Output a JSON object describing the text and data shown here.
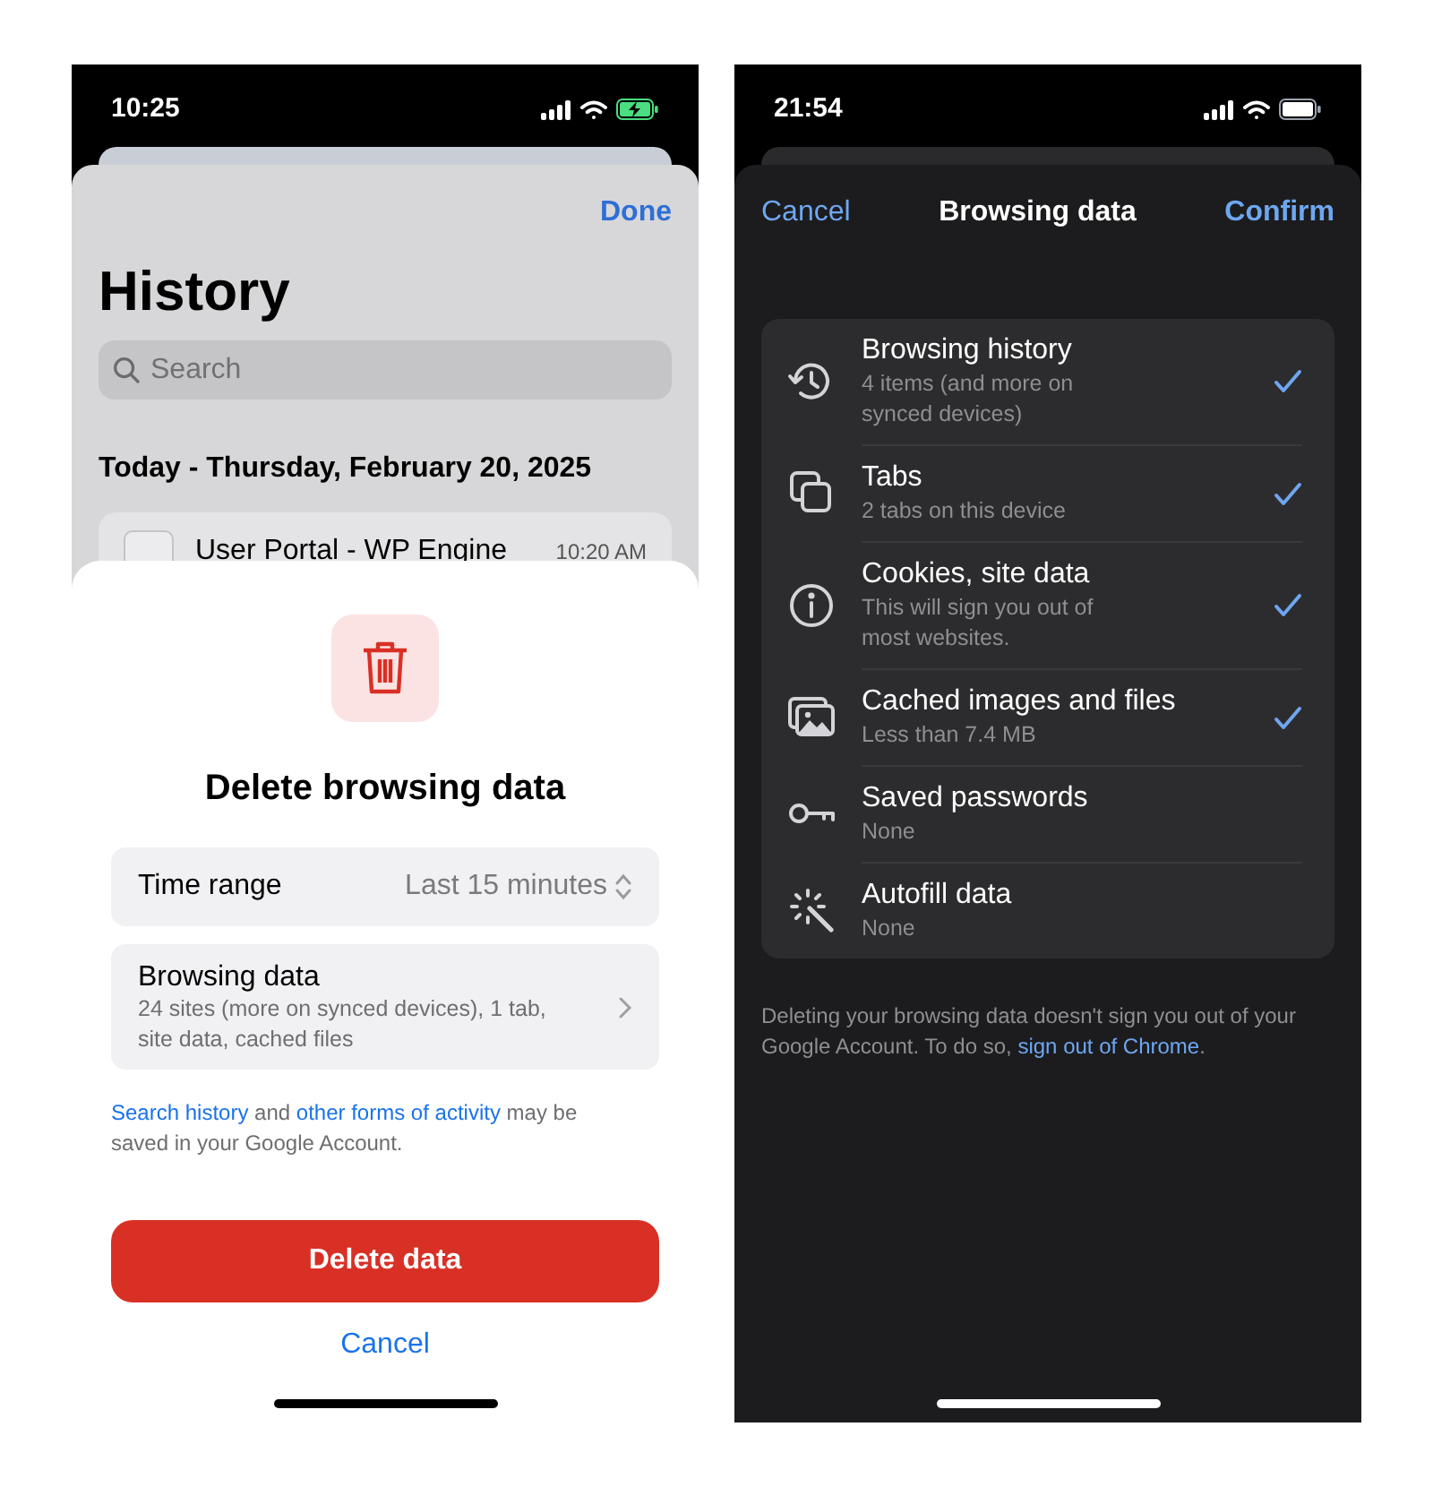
{
  "left_phone": {
    "status_bar": {
      "time": "10:25",
      "battery_charging": true
    },
    "history": {
      "done": "Done",
      "title": "History",
      "search": {
        "placeholder": "Search"
      },
      "date_heading": "Today - Thursday, February 20, 2025",
      "entry": {
        "title": "User Portal - WP Engine",
        "time": "10:20 AM"
      }
    },
    "sheet": {
      "title": "Delete browsing data",
      "time_range": {
        "label": "Time range",
        "value": "Last 15 minutes"
      },
      "browsing_data": {
        "label": "Browsing data",
        "detail": "24 sites (more on synced devices), 1 tab, site data, cached files"
      },
      "note": [
        {
          "kind": "link",
          "text": "Search history"
        },
        {
          "kind": "text",
          "text": " and "
        },
        {
          "kind": "link",
          "text": "other forms of activity"
        },
        {
          "kind": "text",
          "text": " may be saved in your Google Account."
        }
      ],
      "delete_button": "Delete data",
      "cancel": "Cancel"
    }
  },
  "right_phone": {
    "status_bar": {
      "time": "21:54",
      "battery_charging": false
    },
    "header": {
      "cancel": "Cancel",
      "title": "Browsing data",
      "confirm": "Confirm"
    },
    "items": [
      {
        "title": "Browsing history",
        "detail": "4 items (and more on synced devices)",
        "checked": true
      },
      {
        "title": "Tabs",
        "detail": "2 tabs on this device",
        "checked": true
      },
      {
        "title": "Cookies, site data",
        "detail": "This will sign you out of most websites.",
        "checked": true
      },
      {
        "title": "Cached images and files",
        "detail": "Less than 7.4 MB",
        "checked": true
      },
      {
        "title": "Saved passwords",
        "detail": "None",
        "checked": false
      },
      {
        "title": "Autofill data",
        "detail": "None",
        "checked": false
      }
    ],
    "footer": [
      {
        "kind": "text",
        "text": "Deleting your browsing data doesn't sign you out of your Google Account. To do so, "
      },
      {
        "kind": "link",
        "text": "sign out of Chrome"
      },
      {
        "kind": "text",
        "text": "."
      }
    ]
  }
}
